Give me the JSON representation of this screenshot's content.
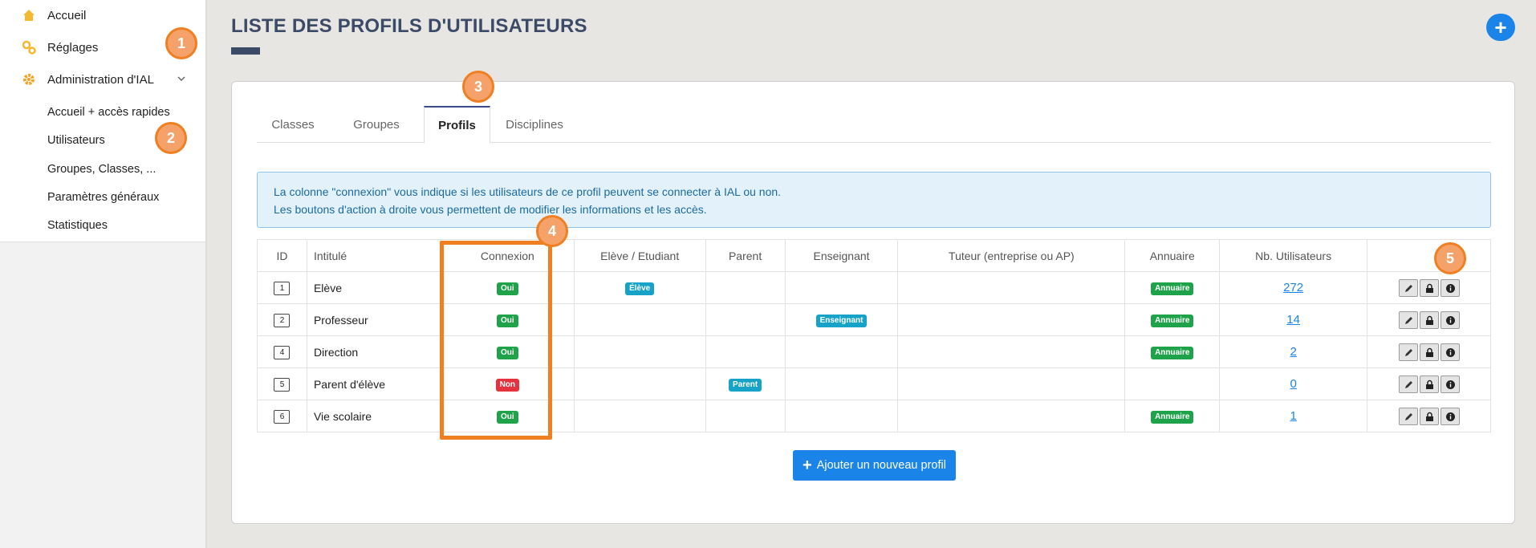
{
  "sidebar": {
    "items": [
      {
        "label": "Accueil",
        "icon": "home-icon"
      },
      {
        "label": "Réglages",
        "icon": "settings-icon"
      },
      {
        "label": "Administration d'IAL",
        "icon": "gear-icon"
      }
    ],
    "sub_items": [
      "Accueil + accès rapides",
      "Utilisateurs",
      "Groupes, Classes, ...",
      "Paramètres généraux",
      "Statistiques"
    ]
  },
  "header": {
    "title": "LISTE DES PROFILS D'UTILISATEURS",
    "add_symbol": "+"
  },
  "tabs": [
    {
      "label": "Classes"
    },
    {
      "label": "Groupes"
    },
    {
      "label": "Profils"
    },
    {
      "label": "Disciplines"
    }
  ],
  "info": {
    "line1": "La colonne \"connexion\" vous indique si les utilisateurs de ce profil peuvent se connecter à IAL ou non.",
    "line2": "Les boutons d'action à droite vous permettent de modifier les informations et les accès."
  },
  "table": {
    "headers": [
      "ID",
      "Intitulé",
      "Connexion",
      "Elève / Etudiant",
      "Parent",
      "Enseignant",
      "Tuteur (entreprise ou AP)",
      "Annuaire",
      "Nb. Utilisateurs",
      ""
    ],
    "rows": [
      {
        "id": "1",
        "name": "Elève",
        "connexion": "Oui",
        "eleve": "Élève",
        "parent": "",
        "enseignant": "",
        "tuteur": "",
        "annuaire": "Annuaire",
        "count": "272"
      },
      {
        "id": "2",
        "name": "Professeur",
        "connexion": "Oui",
        "eleve": "",
        "parent": "",
        "enseignant": "Enseignant",
        "tuteur": "",
        "annuaire": "Annuaire",
        "count": "14"
      },
      {
        "id": "4",
        "name": "Direction",
        "connexion": "Oui",
        "eleve": "",
        "parent": "",
        "enseignant": "",
        "tuteur": "",
        "annuaire": "Annuaire",
        "count": "2"
      },
      {
        "id": "5",
        "name": "Parent d'élève",
        "connexion": "Non",
        "eleve": "",
        "parent": "Parent",
        "enseignant": "",
        "tuteur": "",
        "annuaire": "",
        "count": "0"
      },
      {
        "id": "6",
        "name": "Vie scolaire",
        "connexion": "Oui",
        "eleve": "",
        "parent": "",
        "enseignant": "",
        "tuteur": "",
        "annuaire": "Annuaire",
        "count": "1"
      }
    ]
  },
  "add_button": {
    "label": "Ajouter un nouveau profil"
  },
  "markers": [
    "1",
    "2",
    "3",
    "4",
    "5"
  ],
  "colors": {
    "primary": "#1a84e8",
    "title": "#3b4a66",
    "success": "#1fa34a",
    "danger": "#e5323f",
    "info": "#17a2c8",
    "annotation": "#f07f22"
  }
}
